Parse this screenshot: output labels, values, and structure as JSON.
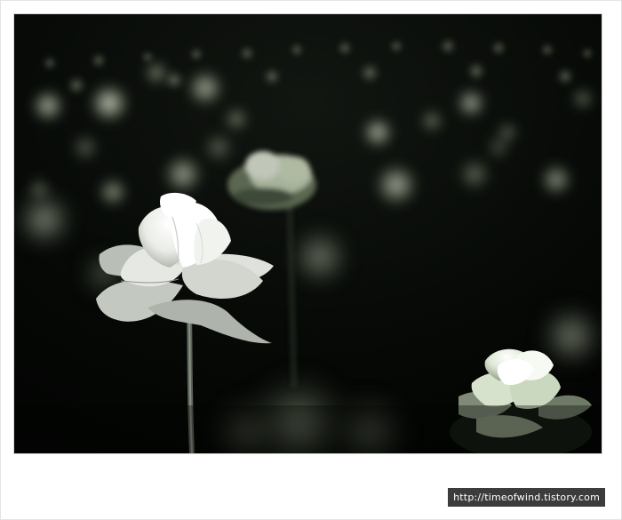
{
  "image": {
    "description_kind": "photo",
    "palette": {
      "background": "#050806",
      "bokeh": "#e8f2d8",
      "petal": "#f4f6f2",
      "stem": "#6b7268"
    }
  },
  "watermark": {
    "text": "http://timeofwind.tistory.com"
  }
}
